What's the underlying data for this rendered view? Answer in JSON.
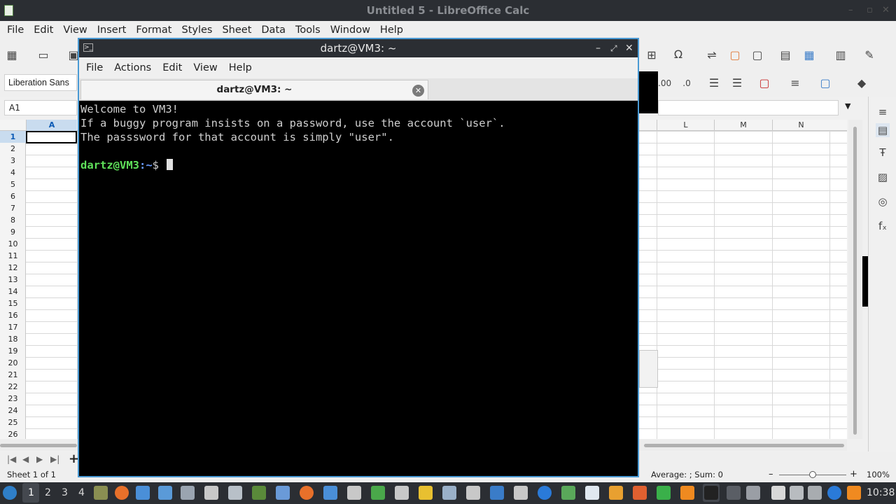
{
  "calc": {
    "window_title": "Untitled 5 - LibreOffice Calc",
    "menu": [
      "File",
      "Edit",
      "View",
      "Insert",
      "Format",
      "Styles",
      "Sheet",
      "Data",
      "Tools",
      "Window",
      "Help"
    ],
    "font_name": "Liberation Sans",
    "name_box": "A1",
    "visible_columns": [
      "A",
      "L",
      "M",
      "N"
    ],
    "rows": [
      "1",
      "2",
      "3",
      "4",
      "5",
      "6",
      "7",
      "8",
      "9",
      "10",
      "11",
      "12",
      "13",
      "14",
      "15",
      "16",
      "17",
      "18",
      "19",
      "20",
      "21",
      "22",
      "23",
      "24",
      "25",
      "26"
    ],
    "selected_row": "1",
    "sheet_status": "Sheet 1 of 1",
    "sum_status": "Average: ; Sum: 0",
    "zoom": "100%"
  },
  "terminal": {
    "window_title": "dartz@VM3: ~",
    "menu": [
      "File",
      "Actions",
      "Edit",
      "View",
      "Help"
    ],
    "tab_title": "dartz@VM3: ~",
    "lines": [
      "Welcome to VM3!",
      "If a buggy program insists on a password, use the account `user`.",
      "The passsword for that account is simply \"user\"."
    ],
    "prompt_user": "dartz@VM3",
    "prompt_path": ":~",
    "prompt_symbol": "$"
  },
  "taskbar": {
    "workspaces": [
      "1",
      "2",
      "3",
      "4"
    ],
    "clock": "10:38"
  }
}
